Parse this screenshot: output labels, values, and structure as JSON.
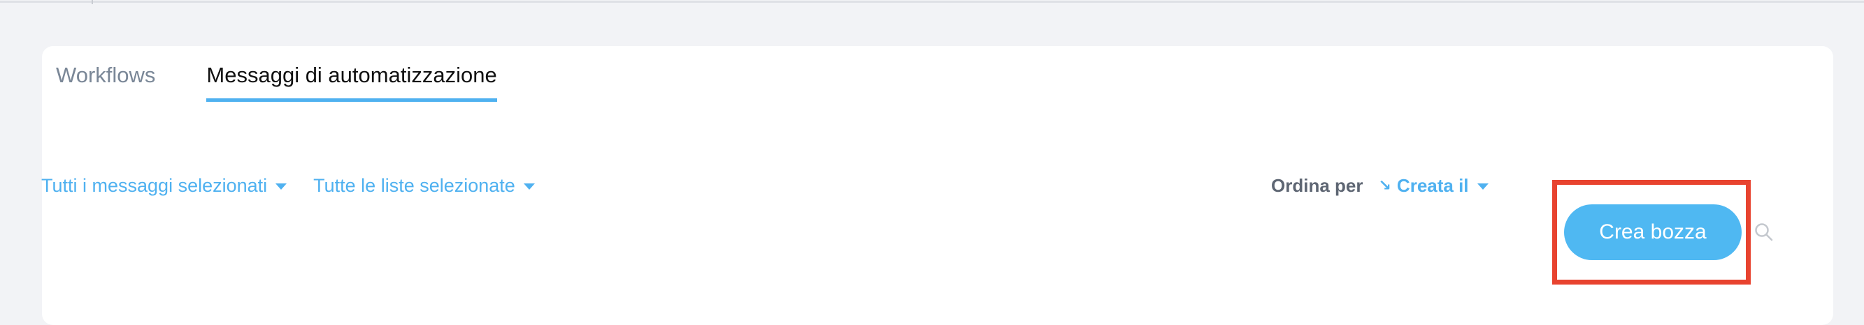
{
  "tabs": [
    {
      "label": "Workflows",
      "active": false
    },
    {
      "label": "Messaggi di automatizzazione",
      "active": true
    }
  ],
  "filters": {
    "messages_label": "Tutti i messaggi selezionati",
    "lists_label": "Tutte le liste selezionate"
  },
  "sort": {
    "label": "Ordina per",
    "value": "Creata il",
    "direction_icon": "sort-descending-icon"
  },
  "actions": {
    "create_label": "Crea bozza"
  },
  "colors": {
    "accent": "#4fb1f0",
    "highlight": "#e8432f",
    "background": "#f2f3f6"
  }
}
